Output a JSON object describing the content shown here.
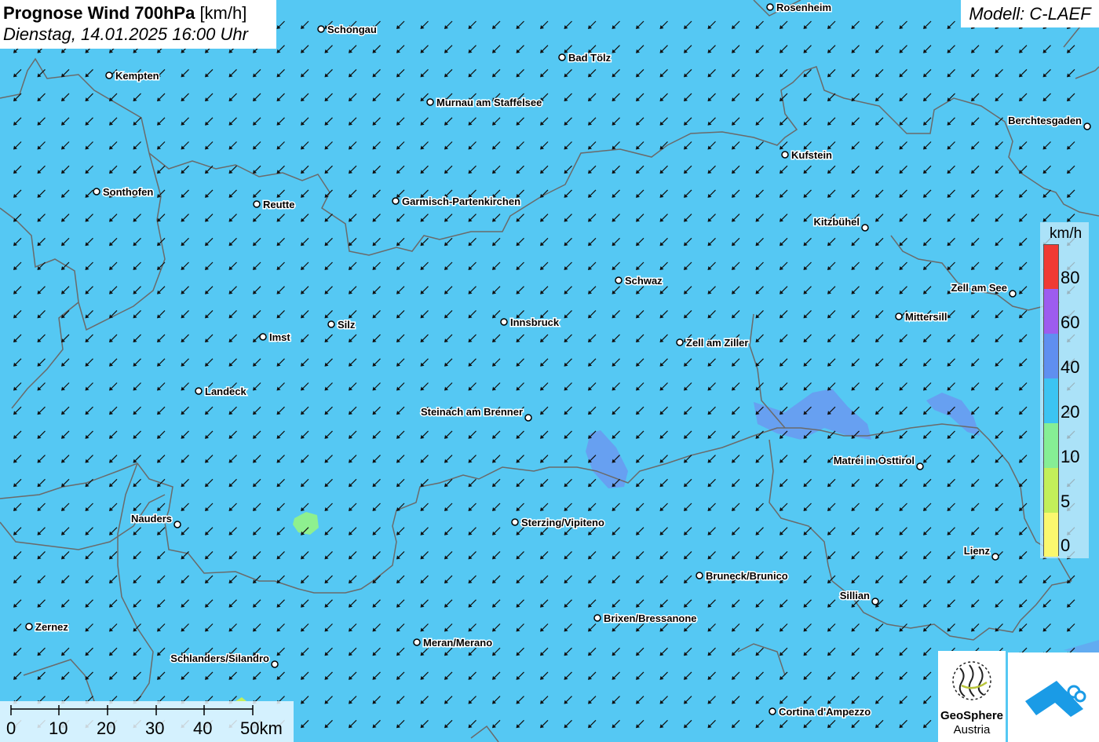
{
  "title": {
    "bold": "Prognose Wind 700hPa",
    "unit": "[km/h]",
    "datetime": "Dienstag, 14.01.2025 16:00 Uhr"
  },
  "model": "Modell: C-LAEF",
  "legend": {
    "unit": "km/h",
    "classes": [
      {
        "label": "80",
        "color": "#f03a33"
      },
      {
        "label": "60",
        "color": "#9d5cef"
      },
      {
        "label": "40",
        "color": "#5f8ff0"
      },
      {
        "label": "20",
        "color": "#3cc4f2"
      },
      {
        "label": "10",
        "color": "#86ee95"
      },
      {
        "label": "5",
        "color": "#c3ef5a"
      },
      {
        "label": "0",
        "color": "#fbf86e"
      }
    ]
  },
  "scalebar": {
    "labels": [
      "0",
      "10",
      "20",
      "30",
      "40",
      "50km"
    ]
  },
  "logo": {
    "line1": "GeoSphere",
    "line2": "Austria"
  },
  "colors": {
    "background": "#55c8f3",
    "stronger_wind": "#6f8ff0",
    "weak_wind": "#8ef08f",
    "border": "#6a6a6a",
    "arrow": "#111111"
  },
  "wind_direction": "from northeast",
  "cities": [
    {
      "name": "Rosenheim",
      "label_side": "right"
    },
    {
      "name": "Schongau",
      "label_side": "right"
    },
    {
      "name": "Bad Tölz",
      "label_side": "right"
    },
    {
      "name": "Kempten",
      "label_side": "right"
    },
    {
      "name": "Murnau am Staffelsee",
      "label_side": "right"
    },
    {
      "name": "Berchtesgaden",
      "label_side": "left"
    },
    {
      "name": "Kufstein",
      "label_side": "right"
    },
    {
      "name": "Sonthofen",
      "label_side": "right"
    },
    {
      "name": "Reutte",
      "label_side": "right"
    },
    {
      "name": "Garmisch-Partenkirchen",
      "label_side": "right"
    },
    {
      "name": "Kitzbühel",
      "label_side": "left"
    },
    {
      "name": "Schwaz",
      "label_side": "right"
    },
    {
      "name": "Zell am See",
      "label_side": "left"
    },
    {
      "name": "Mittersill",
      "label_side": "right"
    },
    {
      "name": "Silz",
      "label_side": "right"
    },
    {
      "name": "Innsbruck",
      "label_side": "right"
    },
    {
      "name": "Imst",
      "label_side": "right"
    },
    {
      "name": "Zell am Ziller",
      "label_side": "right"
    },
    {
      "name": "Landeck",
      "label_side": "right"
    },
    {
      "name": "Steinach am Brenner",
      "label_side": "left"
    },
    {
      "name": "Matrei in Osttirol",
      "label_side": "left"
    },
    {
      "name": "Nauders",
      "label_side": "left"
    },
    {
      "name": "Sterzing/Vipiteno",
      "label_side": "right"
    },
    {
      "name": "Lienz",
      "label_side": "left"
    },
    {
      "name": "Bruneck/Brunico",
      "label_side": "right"
    },
    {
      "name": "Sillian",
      "label_side": "left"
    },
    {
      "name": "Brixen/Bressanone",
      "label_side": "right"
    },
    {
      "name": "Zernez",
      "label_side": "right"
    },
    {
      "name": "Meran/Merano",
      "label_side": "right"
    },
    {
      "name": "Schlanders/Silandro",
      "label_side": "left"
    },
    {
      "name": "Cortina d'Ampezzo",
      "label_side": "right"
    }
  ]
}
